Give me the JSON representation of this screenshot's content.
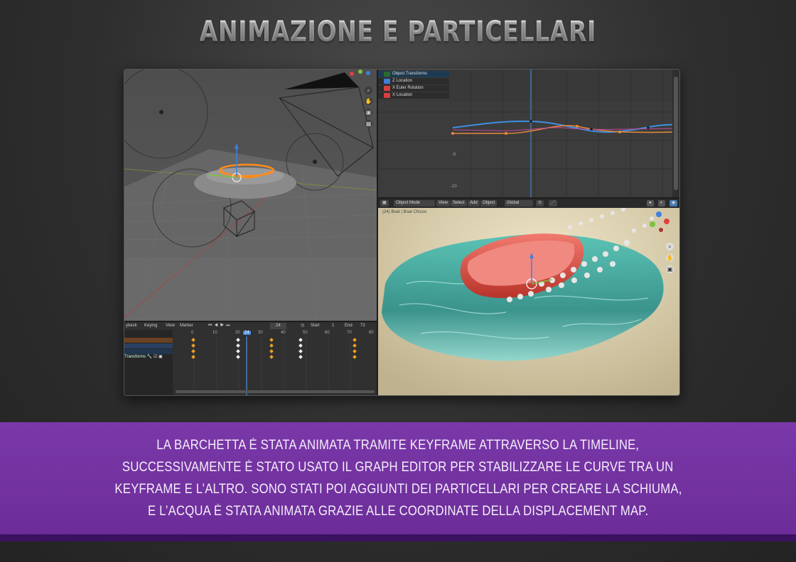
{
  "title": "ANIMAZIONE E PARTICELLARI",
  "caption": {
    "lines": [
      "LA BARCHETTA È STATA ANIMATA TRAMITE KEYFRAME ATTRAVERSO  LA TIMELINE,",
      "SUCCESSIVAMENTE È STATO USATO IL GRAPH EDITOR PER STABILIZZARE LE CURVE TRA UN",
      "KEYFRAME E L’ALTRO. SONO STATI POI AGGIUNTI DEI PARTICELLARI PER CREARE LA SCHIUMA,",
      "E L’ACQUA È STATA ANIMATA GRAZIE ALLE COORDINATE DELLA DISPLACEMENT MAP."
    ]
  },
  "graph_editor": {
    "channels": [
      {
        "label": "Object Transforms",
        "color": "#2b6a2b"
      },
      {
        "label": "Z Location",
        "color": "#3f7fd8"
      },
      {
        "label": "X Euler Rotation",
        "color": "#d83f3f"
      },
      {
        "label": "X Location",
        "color": "#d83f3f"
      }
    ],
    "axis_labels": [
      "-5",
      "-10"
    ]
  },
  "render_viewport": {
    "header": {
      "mode": "Object Mode",
      "menus": [
        "View",
        "Select",
        "Add",
        "Object"
      ],
      "orientation": "Global"
    },
    "overlay_text": "(24) Boat | Boat Chiuso"
  },
  "timeline": {
    "menus": [
      "ybeck",
      "Keying",
      "View",
      "Marker"
    ],
    "current_frame": "24",
    "start_label": "Start",
    "start_value": "1",
    "end_label": "End",
    "end_value": "72",
    "frame_ticks": [
      "0",
      "10",
      "20",
      "24",
      "30",
      "40",
      "50",
      "60",
      "70",
      "80"
    ],
    "tracks": [
      "",
      "",
      "",
      "Transforms"
    ]
  },
  "colors": {
    "caption_band": "#6f2f9c",
    "curve_blue": "#3f8fe0",
    "curve_orange": "#e88a3a",
    "selection_orange": "#ff8c1a",
    "playhead": "#4a90e2"
  }
}
